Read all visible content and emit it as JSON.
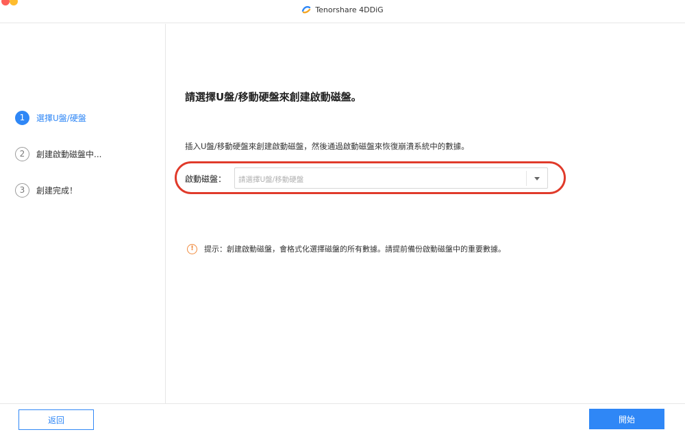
{
  "window": {
    "title": "Tenorshare 4DDiG"
  },
  "steps": [
    {
      "num": "1",
      "label": "選擇U盤/硬盤",
      "active": true
    },
    {
      "num": "2",
      "label": "創建啟動磁盤中...",
      "active": false
    },
    {
      "num": "3",
      "label": "創建完成！",
      "active": false
    }
  ],
  "main": {
    "heading": "請選擇U盤/移動硬盤來創建啟動磁盤。",
    "description": "插入U盤/移動硬盤來創建啟動磁盤，然後通過啟動磁盤來恢復崩潰系統中的數據。",
    "disk_label": "啟動磁盤：",
    "disk_placeholder": "請選擇U盤/移動硬盤",
    "tip_icon": "!",
    "tip": "提示：創建啟動磁盤，會格式化選擇磁盤的所有數據。請提前備份啟動磁盤中的重要數據。"
  },
  "footer": {
    "back_label": "返回",
    "start_label": "開始"
  },
  "colors": {
    "accent": "#2f87f6",
    "highlight": "#e03a2a",
    "warning": "#f08a3c"
  }
}
